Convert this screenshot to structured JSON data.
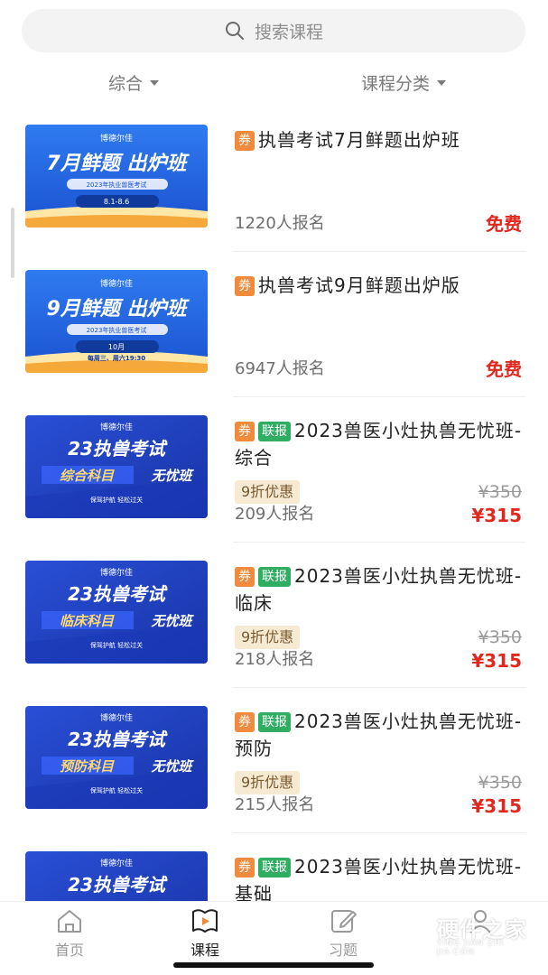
{
  "search": {
    "placeholder": "搜索课程",
    "icon": "search-icon"
  },
  "filters": [
    {
      "label": "综合"
    },
    {
      "label": "课程分类"
    }
  ],
  "courses": [
    {
      "thumb": {
        "brand": "博德尔佳",
        "headline": "7月鲜题 出炉班",
        "subline": "2023年执业兽医考试",
        "date": "8.1-8.6",
        "style": "light"
      },
      "tags": [
        "券"
      ],
      "title": "执兽考试7月鲜题出炉班",
      "enroll": "1220人报名",
      "price": "免费"
    },
    {
      "thumb": {
        "brand": "博德尔佳",
        "headline": "9月鲜题 出炉班",
        "subline": "2023年执业兽医考试",
        "date": "10月",
        "date2": "每周三、周六19:30",
        "style": "light"
      },
      "tags": [
        "券"
      ],
      "title": "执兽考试9月鲜题出炉版",
      "enroll": "6947人报名",
      "price": "免费"
    },
    {
      "thumb": {
        "brand": "博德尔佳",
        "headline": "23执兽考试",
        "subject": "综合科目",
        "tail": "无忧班",
        "slogan": "保驾护航 轻松过关",
        "style": "dark"
      },
      "tags": [
        "券",
        "联报"
      ],
      "title": "2023兽医小灶执兽无忧班-综合",
      "discount": "9折优惠",
      "original_price": "¥350",
      "enroll": "209人报名",
      "price": "¥315"
    },
    {
      "thumb": {
        "brand": "博德尔佳",
        "headline": "23执兽考试",
        "subject": "临床科目",
        "tail": "无忧班",
        "slogan": "保驾护航 轻松过关",
        "style": "dark"
      },
      "tags": [
        "券",
        "联报"
      ],
      "title": "2023兽医小灶执兽无忧班-临床",
      "discount": "9折优惠",
      "original_price": "¥350",
      "enroll": "218人报名",
      "price": "¥315"
    },
    {
      "thumb": {
        "brand": "博德尔佳",
        "headline": "23执兽考试",
        "subject": "预防科目",
        "tail": "无忧班",
        "slogan": "保驾护航 轻松过关",
        "style": "dark"
      },
      "tags": [
        "券",
        "联报"
      ],
      "title": "2023兽医小灶执兽无忧班-预防",
      "discount": "9折优惠",
      "original_price": "¥350",
      "enroll": "215人报名",
      "price": "¥315"
    },
    {
      "thumb": {
        "brand": "博德尔佳",
        "headline": "23执兽考试",
        "style": "dark"
      },
      "tags": [
        "券",
        "联报"
      ],
      "title": "2023兽医小灶执兽无忧班-基础"
    }
  ],
  "tabbar": [
    {
      "label": "首页",
      "icon": "home-icon",
      "active": false
    },
    {
      "label": "课程",
      "icon": "course-play-icon",
      "active": true
    },
    {
      "label": "习题",
      "icon": "exercise-edit-icon",
      "active": false
    },
    {
      "label": "",
      "icon": "profile-icon",
      "active": false
    }
  ],
  "watermark": {
    "text": "硬件之家",
    "sub": "YING JIAN ZHI JIA.COM"
  },
  "colors": {
    "price_red": "#e0281e",
    "tag_orange": "#f08a3c",
    "tag_green": "#2fae62",
    "thumb_blue": "#1c57d6"
  }
}
